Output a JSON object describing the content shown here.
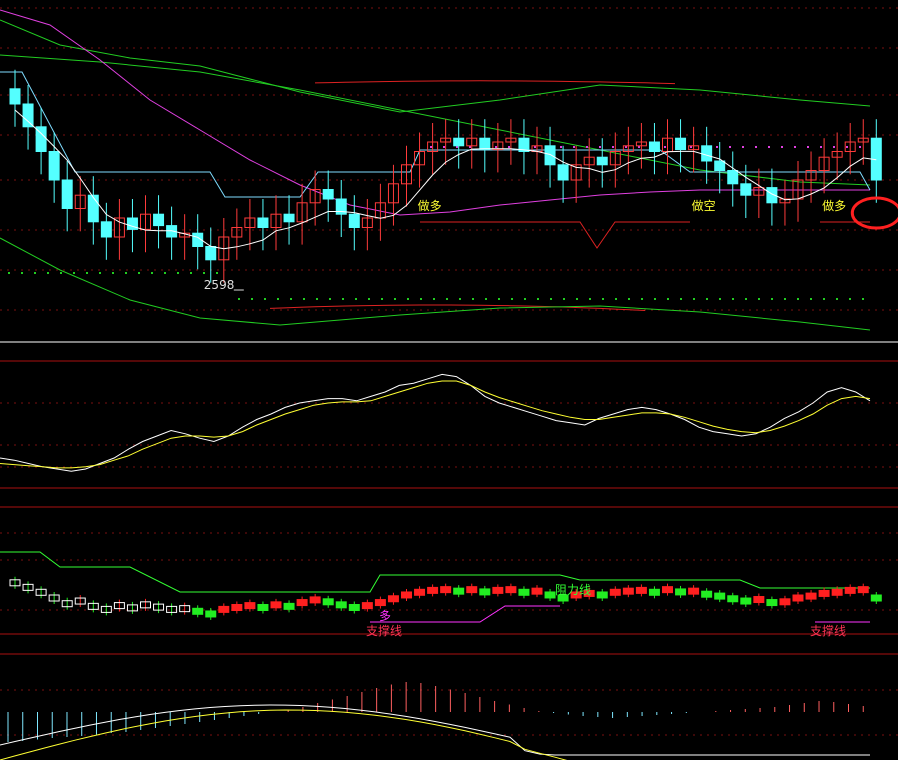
{
  "colors": {
    "background": "#000000",
    "up": "#ff3b3b",
    "down": "#54ffff",
    "ma_green": "#22cc22",
    "ma_magenta": "#e040e0",
    "ma_white": "#ffffff",
    "stop_line": "#7fdcff",
    "band_red": "#dd2222",
    "label_yellow": "#ffff33",
    "grid": "#7a1010",
    "support_red": "#ff3355",
    "resist_green": "#33ff33",
    "long_magenta": "#ff33ff"
  },
  "annotations": {
    "low_price": "2598",
    "buy_1": "做多",
    "sell_1": "做空",
    "buy_2": "做多"
  },
  "panel3": {
    "support_1": "支撑线",
    "support_2": "支撑线",
    "resistance": "阻力线",
    "long": "多"
  },
  "chart_data": [
    {
      "type": "candlestick",
      "panel": "price",
      "bars": 67,
      "close": [
        2680,
        2668,
        2655,
        2640,
        2625,
        2632,
        2618,
        2610,
        2620,
        2614,
        2622,
        2616,
        2610,
        2612,
        2605,
        2598,
        2610,
        2615,
        2620,
        2615,
        2622,
        2618,
        2628,
        2635,
        2630,
        2622,
        2615,
        2620,
        2628,
        2638,
        2648,
        2655,
        2660,
        2662,
        2658,
        2662,
        2656,
        2660,
        2662,
        2655,
        2658,
        2648,
        2640,
        2648,
        2652,
        2648,
        2655,
        2658,
        2660,
        2655,
        2662,
        2656,
        2658,
        2650,
        2645,
        2638,
        2632,
        2636,
        2628,
        2630,
        2640,
        2645,
        2652,
        2655,
        2660,
        2662,
        2640
      ],
      "annotations": [
        {
          "type": "label",
          "bar": 16,
          "text": "2598"
        },
        {
          "type": "label",
          "bar": 32,
          "text": "做多"
        },
        {
          "type": "label",
          "bar": 53,
          "text": "做空"
        },
        {
          "type": "label",
          "bar": 63,
          "text": "做多"
        },
        {
          "type": "highlight",
          "bar": 66,
          "shape": "circle"
        }
      ]
    },
    {
      "type": "line",
      "panel": "oscillator",
      "series": [
        {
          "values": [
            20,
            18,
            15,
            12,
            10,
            8,
            10,
            15,
            20,
            28,
            35,
            40,
            45,
            42,
            38,
            35,
            40,
            48,
            55,
            60,
            66,
            70,
            72,
            74,
            74,
            72,
            76,
            80,
            86,
            88,
            92,
            96,
            94,
            86,
            76,
            70,
            66,
            62,
            58,
            54,
            52,
            50,
            56,
            60,
            64,
            66,
            64,
            60,
            55,
            48,
            44,
            42,
            40,
            42,
            48,
            56,
            62,
            70,
            80,
            84,
            80,
            72
          ]
        },
        {
          "values": [
            15,
            14,
            13,
            12,
            11,
            11,
            12,
            14,
            18,
            22,
            28,
            33,
            38,
            40,
            40,
            39,
            40,
            44,
            50,
            55,
            60,
            64,
            68,
            70,
            71,
            71,
            72,
            76,
            80,
            84,
            88,
            90,
            90,
            86,
            80,
            75,
            71,
            67,
            63,
            60,
            57,
            55,
            55,
            57,
            59,
            61,
            61,
            60,
            57,
            53,
            49,
            46,
            44,
            43,
            45,
            49,
            54,
            60,
            68,
            74,
            76,
            74
          ]
        }
      ]
    },
    {
      "type": "bar",
      "panel": "momentum",
      "values": [
        -60,
        -58,
        -55,
        -52,
        -50,
        -48,
        -45,
        -42,
        -40,
        -36,
        -32,
        -28,
        -24,
        -20,
        -16,
        -12,
        -8,
        -4,
        0,
        5,
        10,
        18,
        25,
        32,
        40,
        48,
        55,
        60,
        58,
        52,
        45,
        38,
        30,
        22,
        15,
        8,
        2,
        -2,
        -5,
        -8,
        -10,
        -12,
        -10,
        -8,
        -6,
        -4,
        -2,
        0,
        2,
        4,
        6,
        8,
        10,
        14,
        18,
        22,
        20,
        16,
        12
      ]
    }
  ]
}
